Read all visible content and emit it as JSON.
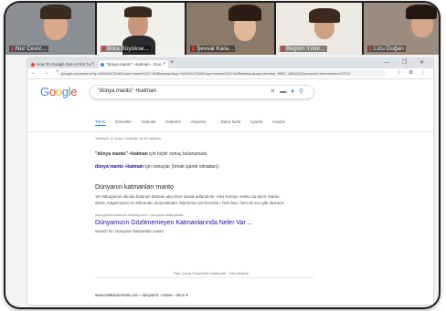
{
  "participants": [
    {
      "name": "Nur Ceviz..."
    },
    {
      "name": "Bora Büyükse..."
    },
    {
      "name": "Şevval Kara..."
    },
    {
      "name": "Begüm Yıldır..."
    },
    {
      "name": "Lizu Doğan"
    }
  ],
  "browser": {
    "tabs": [
      {
        "label": "How To Google Get A First Tu..."
      },
      {
        "label": "\"dünya manto\" +katman - Goo..."
      }
    ],
    "new_tab": "+",
    "window_controls": "— ❐ ✕",
    "url": "google.com/search?q=%22d%C3%BCnya+manto%22+%2Bkatman&oq=%22d%C3%BCnya+manto%22+%2Bkatman&aqs=chrome..69i57.4982j0j7&sourceid=chrome&ie=UTF-8",
    "nav_icons": "← → ↻",
    "ext_icons": "☆ ⚙ ⋮"
  },
  "google": {
    "logo": "Google",
    "query": "\"dünya manto\" +katman",
    "tabs": [
      "Tümü",
      "Görseller",
      "Videolar",
      "Haberler",
      "Alışveriş",
      "⋮ Daha fazla",
      "Ayarlar",
      "Araçlar"
    ],
    "stats": "Yaklaşık 42 sonuç bulundu (0,38 saniye)",
    "no_results_bold": "\"dünya manto\" +katman",
    "no_results_rest": " için hiçbir sonuç bulunamadı.",
    "suggestion_bold": "dünya manto +katman",
    "suggestion_rest": " için sonuçlar (tırnak işareti olmadan):",
    "result": {
      "title": "Dünyanın katmanları manto",
      "snippet": "Yer kabuğunun altında bulunan katman ateş küre olarak adlandırılır. Ateş Küreye manto da denir. Manto, demir, magnezyum ve silikondan oluşmaktadır. Mantonun üst kısımları, hem katı, hem de sıvı gibi davranır.",
      "url": "jeologimmotorkursu.weebly.com › dunyanin-katmanlari...",
      "link": "Dünyamızın Gözlenemeyen Katmanlarında Neler Var ...",
      "sub": "Search for: Dünyanın katmanları manto"
    },
    "feedback": "Öne Çıkan Snippet'ler Hakkında  ·  Geri bildirim",
    "bottom_url": "www.vatikanaresaat.com › dunyamiz › kimse › derin ▾"
  }
}
